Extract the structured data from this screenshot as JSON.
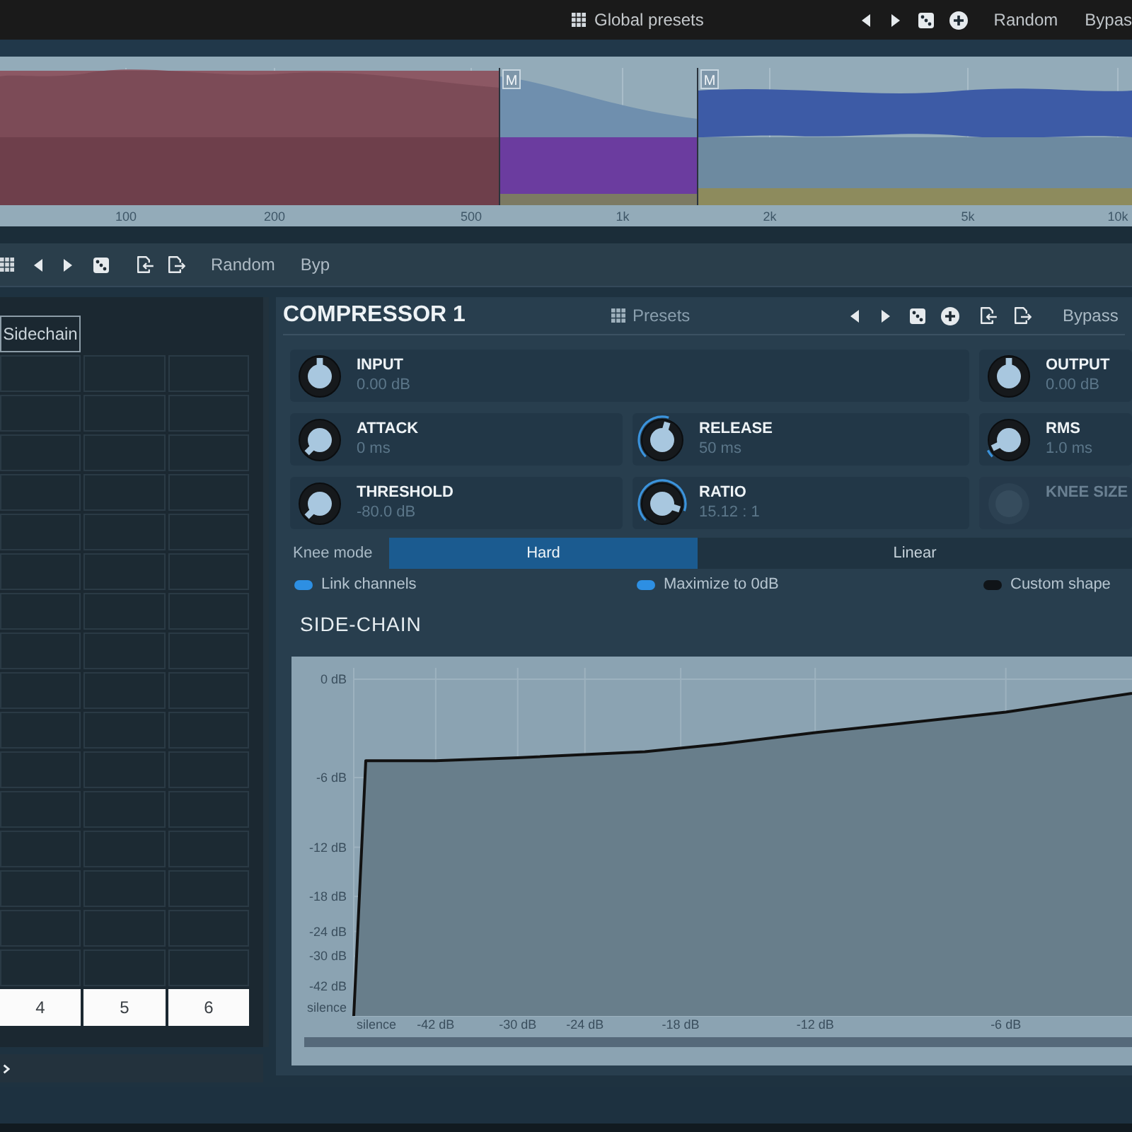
{
  "top_bar": {
    "presets_label": "Global presets",
    "random_label": "Random",
    "bypass_label": "Bypas"
  },
  "spectrum": {
    "bands": [
      {
        "color": "#7c4b57"
      },
      {
        "color": "#6b3c9f",
        "marker": "M"
      },
      {
        "color": "#3d5ba6",
        "marker": "M"
      }
    ],
    "frequency_labels": [
      "100",
      "200",
      "500",
      "1k",
      "2k",
      "5k",
      "10k"
    ]
  },
  "module_toolbar": {
    "random_label": "Random",
    "bypass_label": "Byp"
  },
  "routing": {
    "header": "Sidechain",
    "channel_labels": [
      "4",
      "5",
      "6"
    ]
  },
  "compressor": {
    "title": "COMPRESSOR 1",
    "presets_label": "Presets",
    "bypass_label": "Bypass",
    "knob_rows": [
      [
        {
          "label": "INPUT",
          "value": "0.00 dB",
          "kind": "plain",
          "level": 0.5,
          "disabled": false
        },
        {
          "label": "OUTPUT",
          "value": "0.00 dB",
          "kind": "plain",
          "level": 0.5,
          "disabled": false
        }
      ],
      [
        {
          "label": "ATTACK",
          "value": "0 ms",
          "kind": "arc",
          "level": 0,
          "disabled": false
        },
        {
          "label": "RELEASE",
          "value": "50 ms",
          "kind": "arc",
          "level": 0.56,
          "disabled": false
        },
        {
          "label": "RMS",
          "value": "1.0 ms",
          "kind": "arc",
          "level": 0.07,
          "disabled": false
        }
      ],
      [
        {
          "label": "THRESHOLD",
          "value": "-80.0 dB",
          "kind": "arc",
          "level": 0,
          "disabled": false
        },
        {
          "label": "RATIO",
          "value": "15.12 : 1",
          "kind": "arc",
          "level": 0.9,
          "disabled": false
        },
        {
          "label": "KNEE SIZE",
          "kind": "arc",
          "disabled": true
        }
      ]
    ],
    "knee_mode": {
      "label": "Knee mode",
      "options": [
        {
          "label": "Hard",
          "selected": true
        },
        {
          "label": "Linear",
          "selected": false
        }
      ]
    },
    "toggles": [
      {
        "label": "Link channels",
        "on": true
      },
      {
        "label": "Maximize to 0dB",
        "on": true
      },
      {
        "label": "Custom shape",
        "on": false
      }
    ],
    "side_chain": {
      "title": "SIDE-CHAIN",
      "y_axis_labels": [
        "0 dB",
        "-6 dB",
        "-12 dB",
        "-18 dB",
        "-24 dB",
        "-30 dB",
        "-42 dB",
        "silence"
      ],
      "x_axis_labels": [
        "silence",
        "-42 dB",
        "-30 dB",
        "-24 dB",
        "-18 dB",
        "-12 dB",
        "-6 dB"
      ]
    }
  }
}
